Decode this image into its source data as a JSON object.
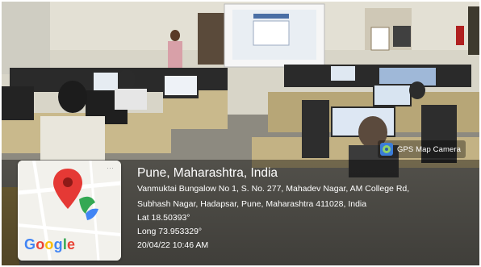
{
  "badge": {
    "label": "GPS Map Camera",
    "icon": "gps-map-camera-icon"
  },
  "location": {
    "title": "Pune, Maharashtra, India",
    "address_line1": "Vanmuktai Bungalow No 1, S. No. 277, Mahadev Nagar, AM College Rd,",
    "address_line2": "Subhash Nagar, Hadapsar, Pune, Maharashtra 411028, India",
    "lat": "Lat 18.50393°",
    "long": "Long 73.953329°",
    "timestamp": "20/04/22 10:46 AM"
  },
  "map": {
    "logo": [
      "G",
      "o",
      "o",
      "g",
      "l",
      "e"
    ],
    "logo_colors": [
      "#4285F4",
      "#EA4335",
      "#FBBC05",
      "#4285F4",
      "#34A853",
      "#EA4335"
    ],
    "pin_color": "#e53935"
  }
}
